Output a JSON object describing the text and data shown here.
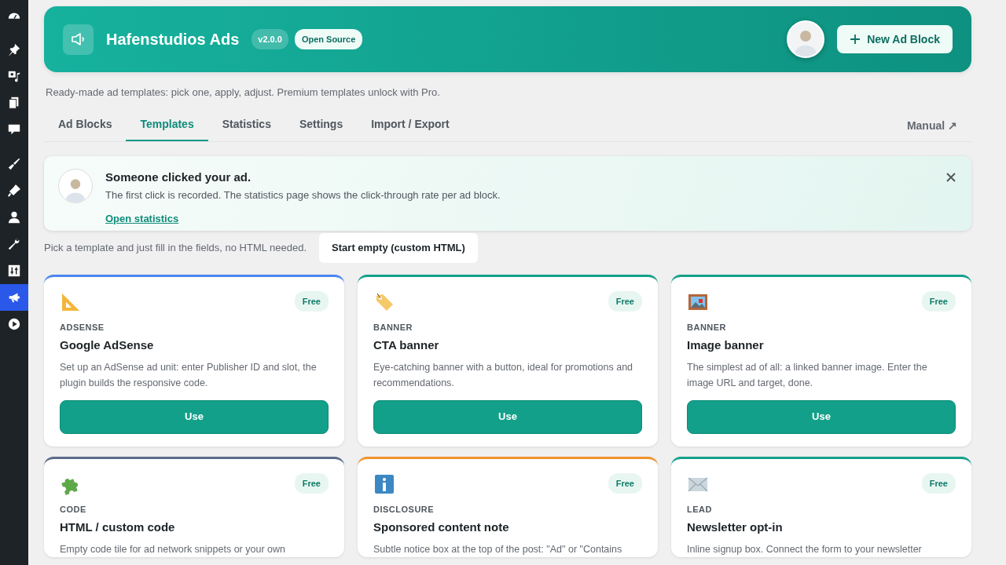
{
  "sidebar": {
    "items": [
      {
        "selected": false
      },
      {
        "selected": false
      },
      {
        "selected": false
      },
      {
        "selected": false
      },
      {
        "selected": false
      },
      {
        "selected": false
      },
      {
        "selected": false
      },
      {
        "selected": false
      },
      {
        "selected": false
      },
      {
        "selected": false
      },
      {
        "selected": true
      },
      {
        "selected": false
      }
    ]
  },
  "header": {
    "title": "Hafenstudios Ads",
    "version": "v2.0.0",
    "badge": "Open Source",
    "button": "New Ad Block"
  },
  "subtitle": "Ready-made ad templates: pick one, apply, adjust. Premium templates unlock with Pro.",
  "tabs": [
    {
      "label": "Ad Blocks",
      "selected": false
    },
    {
      "label": "Templates",
      "selected": true
    },
    {
      "label": "Statistics",
      "selected": false
    },
    {
      "label": "Settings",
      "selected": false
    },
    {
      "label": "Import / Export",
      "selected": false
    }
  ],
  "manual_link": "Manual ↗",
  "notice": {
    "title": "Someone clicked your ad.",
    "text": "The first click is recorded. The statistics page shows the click-through rate per ad block.",
    "link": "Open statistics"
  },
  "hint": "Pick a template and just fill in the fields, no HTML needed.",
  "start_button": "Start empty (custom HTML)",
  "cards": [
    {
      "kind": "ruler",
      "color": "#4a86f0",
      "category": "ADSENSE",
      "title": "Google AdSense",
      "description": "Set up an AdSense ad unit: enter Publisher ID and slot, the plugin builds the responsive code.",
      "badge": "Free",
      "button": "Use"
    },
    {
      "kind": "tag",
      "color": "#14a08a",
      "category": "BANNER",
      "title": "CTA banner",
      "description": "Eye-catching banner with a button, ideal for promotions and recommendations.",
      "badge": "Free",
      "button": "Use"
    },
    {
      "kind": "framed",
      "color": "#14a08a",
      "category": "BANNER",
      "title": "Image banner",
      "description": "The simplest ad of all: a linked banner image. Enter the image URL and target, done.",
      "badge": "Free",
      "button": "Use"
    },
    {
      "kind": "puzzle",
      "color": "#5c6b8a",
      "category": "CODE",
      "title": "HTML / custom code",
      "description": "Empty code tile for ad network snippets or your own",
      "badge": "Free"
    },
    {
      "kind": "info",
      "color": "#f0932b",
      "category": "DISCLOSURE",
      "title": "Sponsored content note",
      "description": "Subtle notice box at the top of the post: \"Ad\" or \"Contains",
      "badge": "Free"
    },
    {
      "kind": "envelope",
      "color": "#14a08a",
      "category": "LEAD",
      "title": "Newsletter opt-in",
      "description": "Inline signup box. Connect the form to your newsletter",
      "badge": "Free"
    }
  ]
}
